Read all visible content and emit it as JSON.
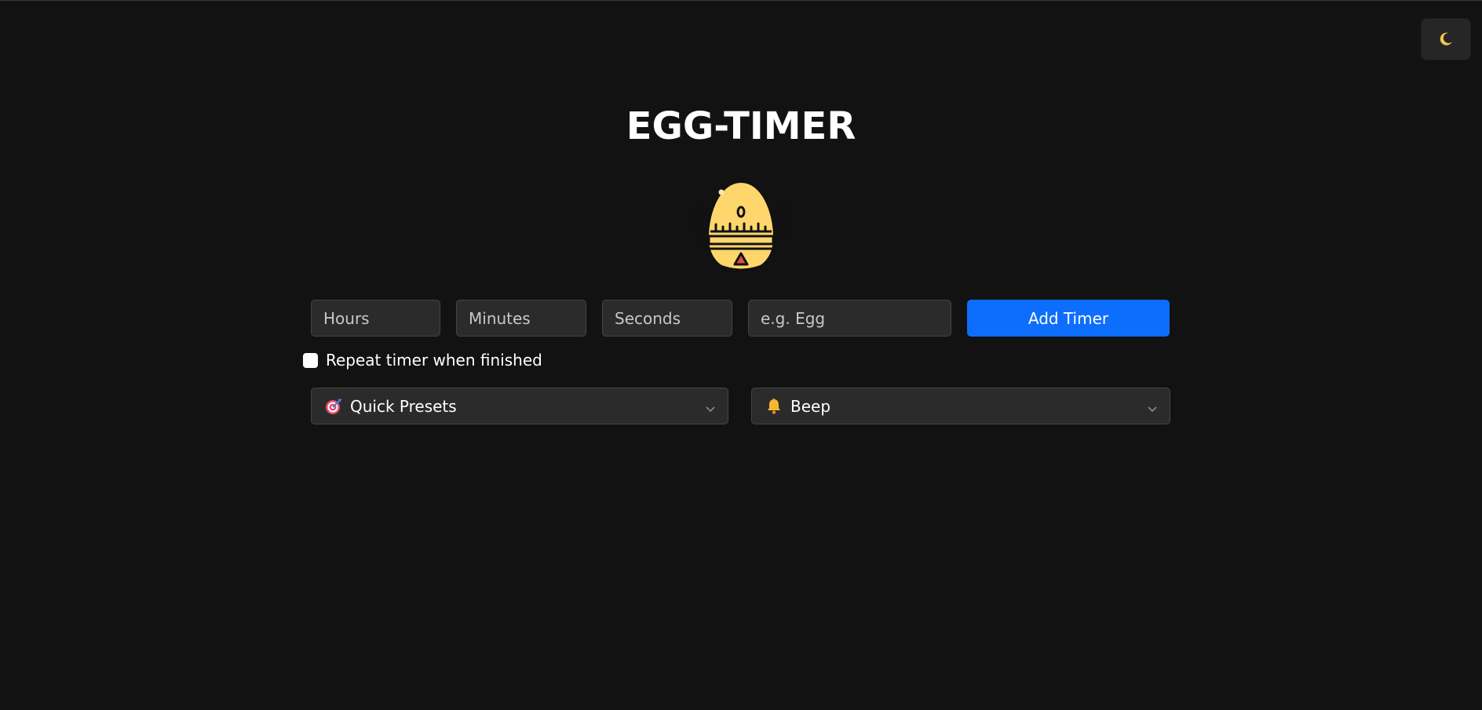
{
  "header": {
    "title": "EGG-TIMER",
    "theme_toggle_icon": "moon-icon"
  },
  "logo": {
    "icon": "egg-timer-icon"
  },
  "form": {
    "hours_placeholder": "Hours",
    "minutes_placeholder": "Minutes",
    "seconds_placeholder": "Seconds",
    "label_placeholder": "e.g. Egg",
    "add_button_label": "Add Timer",
    "repeat_label": "Repeat timer when finished",
    "repeat_checked": false
  },
  "selects": {
    "presets": {
      "icon": "target-icon",
      "label": "Quick Presets"
    },
    "sound": {
      "icon": "bell-icon",
      "label": "Beep"
    }
  },
  "colors": {
    "background": "#121212",
    "accent": "#0d6efd",
    "field_bg": "#2b2b2b",
    "egg_yellow": "#ffd66b"
  }
}
